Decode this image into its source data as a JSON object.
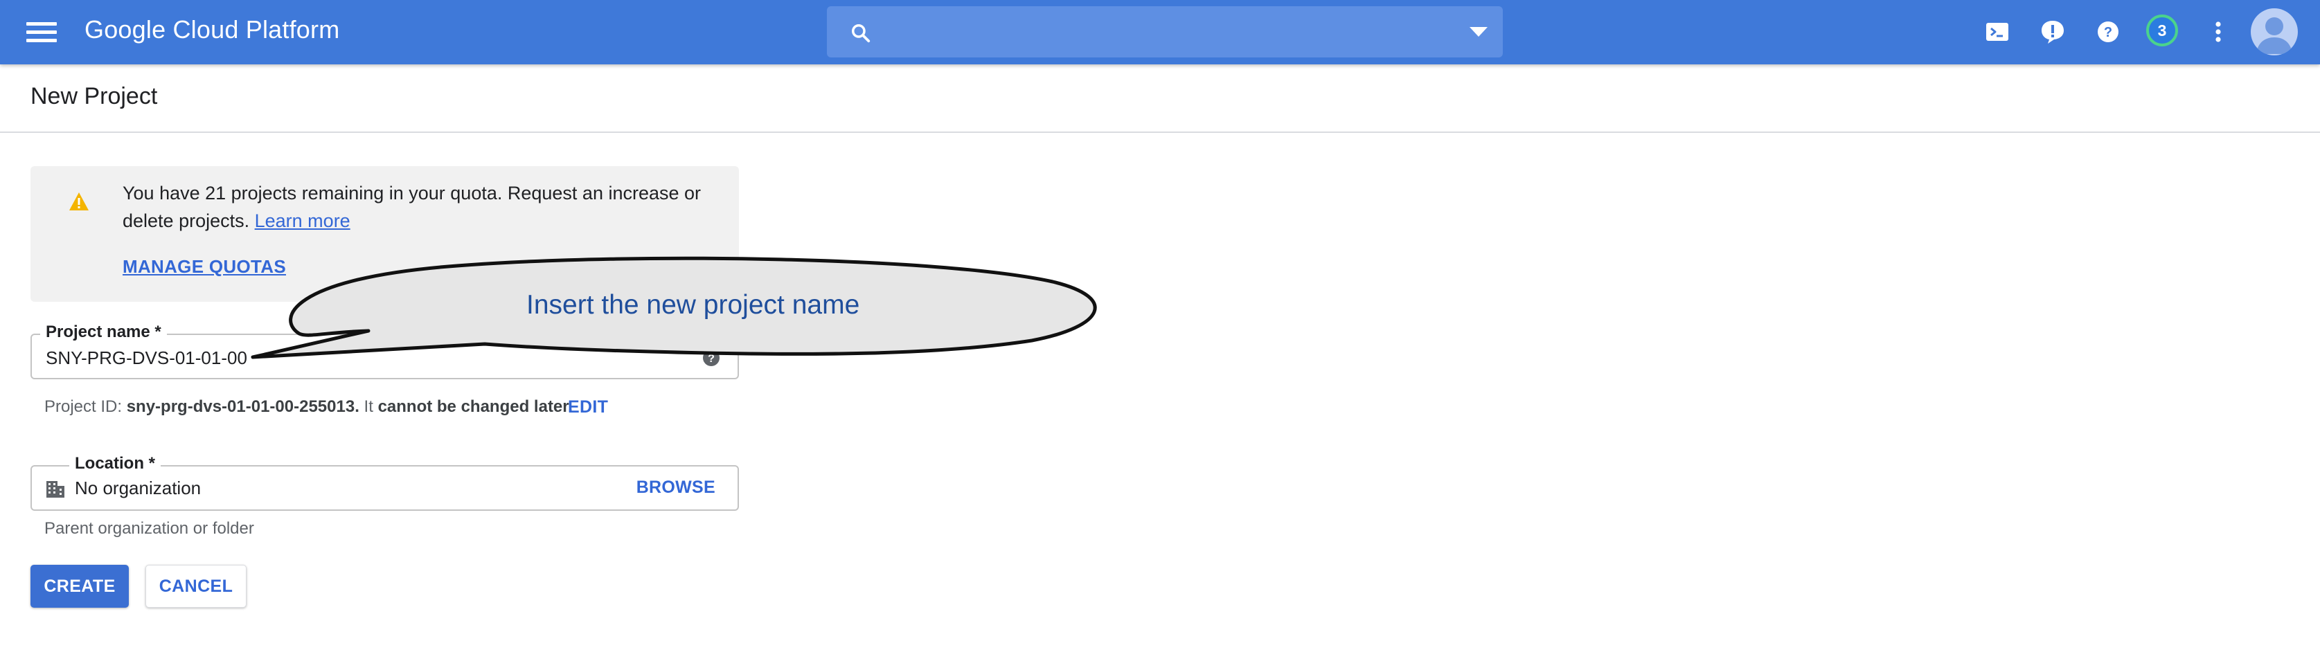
{
  "header": {
    "brand": "Google Cloud Platform",
    "search_placeholder": "",
    "notification_count": "3",
    "icons": [
      "menu-icon",
      "search-icon",
      "dropdown-caret-icon",
      "cloud-shell-icon",
      "feedback-icon",
      "help-icon",
      "more-vert-icon",
      "account-avatar"
    ]
  },
  "page": {
    "title": "New Project"
  },
  "quota_notice": {
    "message": "You have 21 projects remaining in your quota. Request an increase or delete projects.",
    "learn_more": "Learn more",
    "manage_quotas": "MANAGE QUOTAS",
    "icon": "warning-icon"
  },
  "project_name": {
    "label": "Project name *",
    "value": "SNY-PRG-DVS-01-01-00",
    "id_prefix": "Project ID:",
    "id_value": "sny-prg-dvs-01-01-00-255013.",
    "id_note_plain": "It",
    "id_note_bold": "cannot be changed later.",
    "edit": "EDIT"
  },
  "location": {
    "label": "Location *",
    "value": "No organization",
    "browse": "BROWSE",
    "hint": "Parent organization or folder"
  },
  "actions": {
    "create": "CREATE",
    "cancel": "CANCEL"
  },
  "annotation": {
    "text": "Insert the new project name"
  },
  "colors": {
    "header_bg": "#3f79d9",
    "accent": "#3367d6",
    "primary_button": "#3b6fd2",
    "warning": "#f4b400",
    "badge_ring": "#4bd38c"
  }
}
